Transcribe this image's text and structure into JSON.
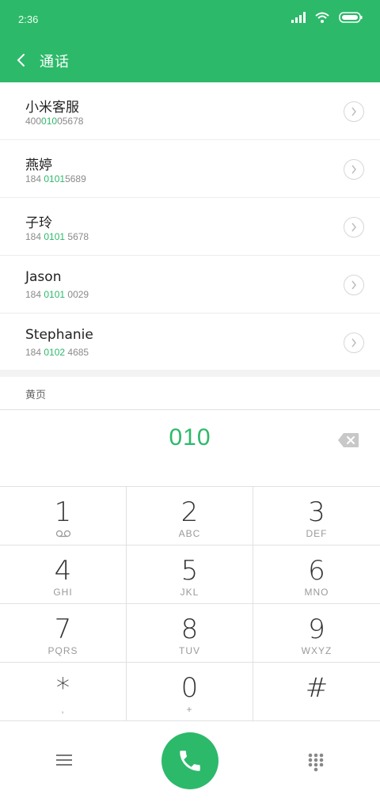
{
  "status_bar": {
    "time": "2:36"
  },
  "header": {
    "title": "通话"
  },
  "contacts": [
    {
      "name": "小米客服",
      "number_pre": "400",
      "number_hl": "010",
      "number_post": "05678"
    },
    {
      "name": "燕婷",
      "number_pre": "184 ",
      "number_hl": "0101",
      "number_post": "5689"
    },
    {
      "name": "子玲",
      "number_pre": "184 ",
      "number_hl": "0101",
      "number_post": " 5678"
    },
    {
      "name": "Jason",
      "number_pre": "184 ",
      "number_hl": "0101",
      "number_post": " 0029"
    },
    {
      "name": "Stephanie",
      "number_pre": "184 ",
      "number_hl": "0102",
      "number_post": " 4685"
    }
  ],
  "yellow_pages": {
    "label": "黄页"
  },
  "dial_input": {
    "value": "010"
  },
  "keypad": [
    {
      "digit": "1",
      "letters": ""
    },
    {
      "digit": "2",
      "letters": "ABC"
    },
    {
      "digit": "3",
      "letters": "DEF"
    },
    {
      "digit": "4",
      "letters": "GHI"
    },
    {
      "digit": "5",
      "letters": "JKL"
    },
    {
      "digit": "6",
      "letters": "MNO"
    },
    {
      "digit": "7",
      "letters": "PQRS"
    },
    {
      "digit": "8",
      "letters": "TUV"
    },
    {
      "digit": "9",
      "letters": "WXYZ"
    },
    {
      "digit": "*",
      "letters": ","
    },
    {
      "digit": "0",
      "letters": "+"
    },
    {
      "digit": "#",
      "letters": ""
    }
  ],
  "colors": {
    "accent": "#2db96a",
    "text": "#222222",
    "muted": "#8a8a8a"
  },
  "icons": {
    "back": "chevron-left-icon",
    "detail": "chevron-right-icon",
    "backspace": "backspace-icon",
    "voicemail": "voicemail-icon",
    "menu": "menu-icon",
    "call": "phone-icon",
    "dialpad": "dialpad-icon"
  }
}
